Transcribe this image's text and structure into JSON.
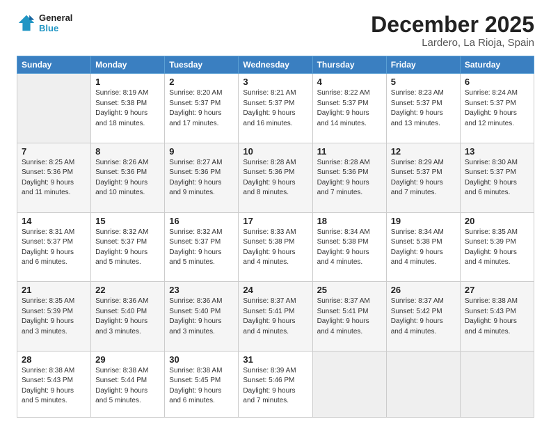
{
  "logo": {
    "text_general": "General",
    "text_blue": "Blue"
  },
  "title": "December 2025",
  "location": "Lardero, La Rioja, Spain",
  "days_of_week": [
    "Sunday",
    "Monday",
    "Tuesday",
    "Wednesday",
    "Thursday",
    "Friday",
    "Saturday"
  ],
  "weeks": [
    [
      {
        "day": "",
        "info": ""
      },
      {
        "day": "1",
        "info": "Sunrise: 8:19 AM\nSunset: 5:38 PM\nDaylight: 9 hours\nand 18 minutes."
      },
      {
        "day": "2",
        "info": "Sunrise: 8:20 AM\nSunset: 5:37 PM\nDaylight: 9 hours\nand 17 minutes."
      },
      {
        "day": "3",
        "info": "Sunrise: 8:21 AM\nSunset: 5:37 PM\nDaylight: 9 hours\nand 16 minutes."
      },
      {
        "day": "4",
        "info": "Sunrise: 8:22 AM\nSunset: 5:37 PM\nDaylight: 9 hours\nand 14 minutes."
      },
      {
        "day": "5",
        "info": "Sunrise: 8:23 AM\nSunset: 5:37 PM\nDaylight: 9 hours\nand 13 minutes."
      },
      {
        "day": "6",
        "info": "Sunrise: 8:24 AM\nSunset: 5:37 PM\nDaylight: 9 hours\nand 12 minutes."
      }
    ],
    [
      {
        "day": "7",
        "info": "Sunrise: 8:25 AM\nSunset: 5:36 PM\nDaylight: 9 hours\nand 11 minutes."
      },
      {
        "day": "8",
        "info": "Sunrise: 8:26 AM\nSunset: 5:36 PM\nDaylight: 9 hours\nand 10 minutes."
      },
      {
        "day": "9",
        "info": "Sunrise: 8:27 AM\nSunset: 5:36 PM\nDaylight: 9 hours\nand 9 minutes."
      },
      {
        "day": "10",
        "info": "Sunrise: 8:28 AM\nSunset: 5:36 PM\nDaylight: 9 hours\nand 8 minutes."
      },
      {
        "day": "11",
        "info": "Sunrise: 8:28 AM\nSunset: 5:36 PM\nDaylight: 9 hours\nand 7 minutes."
      },
      {
        "day": "12",
        "info": "Sunrise: 8:29 AM\nSunset: 5:37 PM\nDaylight: 9 hours\nand 7 minutes."
      },
      {
        "day": "13",
        "info": "Sunrise: 8:30 AM\nSunset: 5:37 PM\nDaylight: 9 hours\nand 6 minutes."
      }
    ],
    [
      {
        "day": "14",
        "info": "Sunrise: 8:31 AM\nSunset: 5:37 PM\nDaylight: 9 hours\nand 6 minutes."
      },
      {
        "day": "15",
        "info": "Sunrise: 8:32 AM\nSunset: 5:37 PM\nDaylight: 9 hours\nand 5 minutes."
      },
      {
        "day": "16",
        "info": "Sunrise: 8:32 AM\nSunset: 5:37 PM\nDaylight: 9 hours\nand 5 minutes."
      },
      {
        "day": "17",
        "info": "Sunrise: 8:33 AM\nSunset: 5:38 PM\nDaylight: 9 hours\nand 4 minutes."
      },
      {
        "day": "18",
        "info": "Sunrise: 8:34 AM\nSunset: 5:38 PM\nDaylight: 9 hours\nand 4 minutes."
      },
      {
        "day": "19",
        "info": "Sunrise: 8:34 AM\nSunset: 5:38 PM\nDaylight: 9 hours\nand 4 minutes."
      },
      {
        "day": "20",
        "info": "Sunrise: 8:35 AM\nSunset: 5:39 PM\nDaylight: 9 hours\nand 4 minutes."
      }
    ],
    [
      {
        "day": "21",
        "info": "Sunrise: 8:35 AM\nSunset: 5:39 PM\nDaylight: 9 hours\nand 3 minutes."
      },
      {
        "day": "22",
        "info": "Sunrise: 8:36 AM\nSunset: 5:40 PM\nDaylight: 9 hours\nand 3 minutes."
      },
      {
        "day": "23",
        "info": "Sunrise: 8:36 AM\nSunset: 5:40 PM\nDaylight: 9 hours\nand 3 minutes."
      },
      {
        "day": "24",
        "info": "Sunrise: 8:37 AM\nSunset: 5:41 PM\nDaylight: 9 hours\nand 4 minutes."
      },
      {
        "day": "25",
        "info": "Sunrise: 8:37 AM\nSunset: 5:41 PM\nDaylight: 9 hours\nand 4 minutes."
      },
      {
        "day": "26",
        "info": "Sunrise: 8:37 AM\nSunset: 5:42 PM\nDaylight: 9 hours\nand 4 minutes."
      },
      {
        "day": "27",
        "info": "Sunrise: 8:38 AM\nSunset: 5:43 PM\nDaylight: 9 hours\nand 4 minutes."
      }
    ],
    [
      {
        "day": "28",
        "info": "Sunrise: 8:38 AM\nSunset: 5:43 PM\nDaylight: 9 hours\nand 5 minutes."
      },
      {
        "day": "29",
        "info": "Sunrise: 8:38 AM\nSunset: 5:44 PM\nDaylight: 9 hours\nand 5 minutes."
      },
      {
        "day": "30",
        "info": "Sunrise: 8:38 AM\nSunset: 5:45 PM\nDaylight: 9 hours\nand 6 minutes."
      },
      {
        "day": "31",
        "info": "Sunrise: 8:39 AM\nSunset: 5:46 PM\nDaylight: 9 hours\nand 7 minutes."
      },
      {
        "day": "",
        "info": ""
      },
      {
        "day": "",
        "info": ""
      },
      {
        "day": "",
        "info": ""
      }
    ]
  ]
}
